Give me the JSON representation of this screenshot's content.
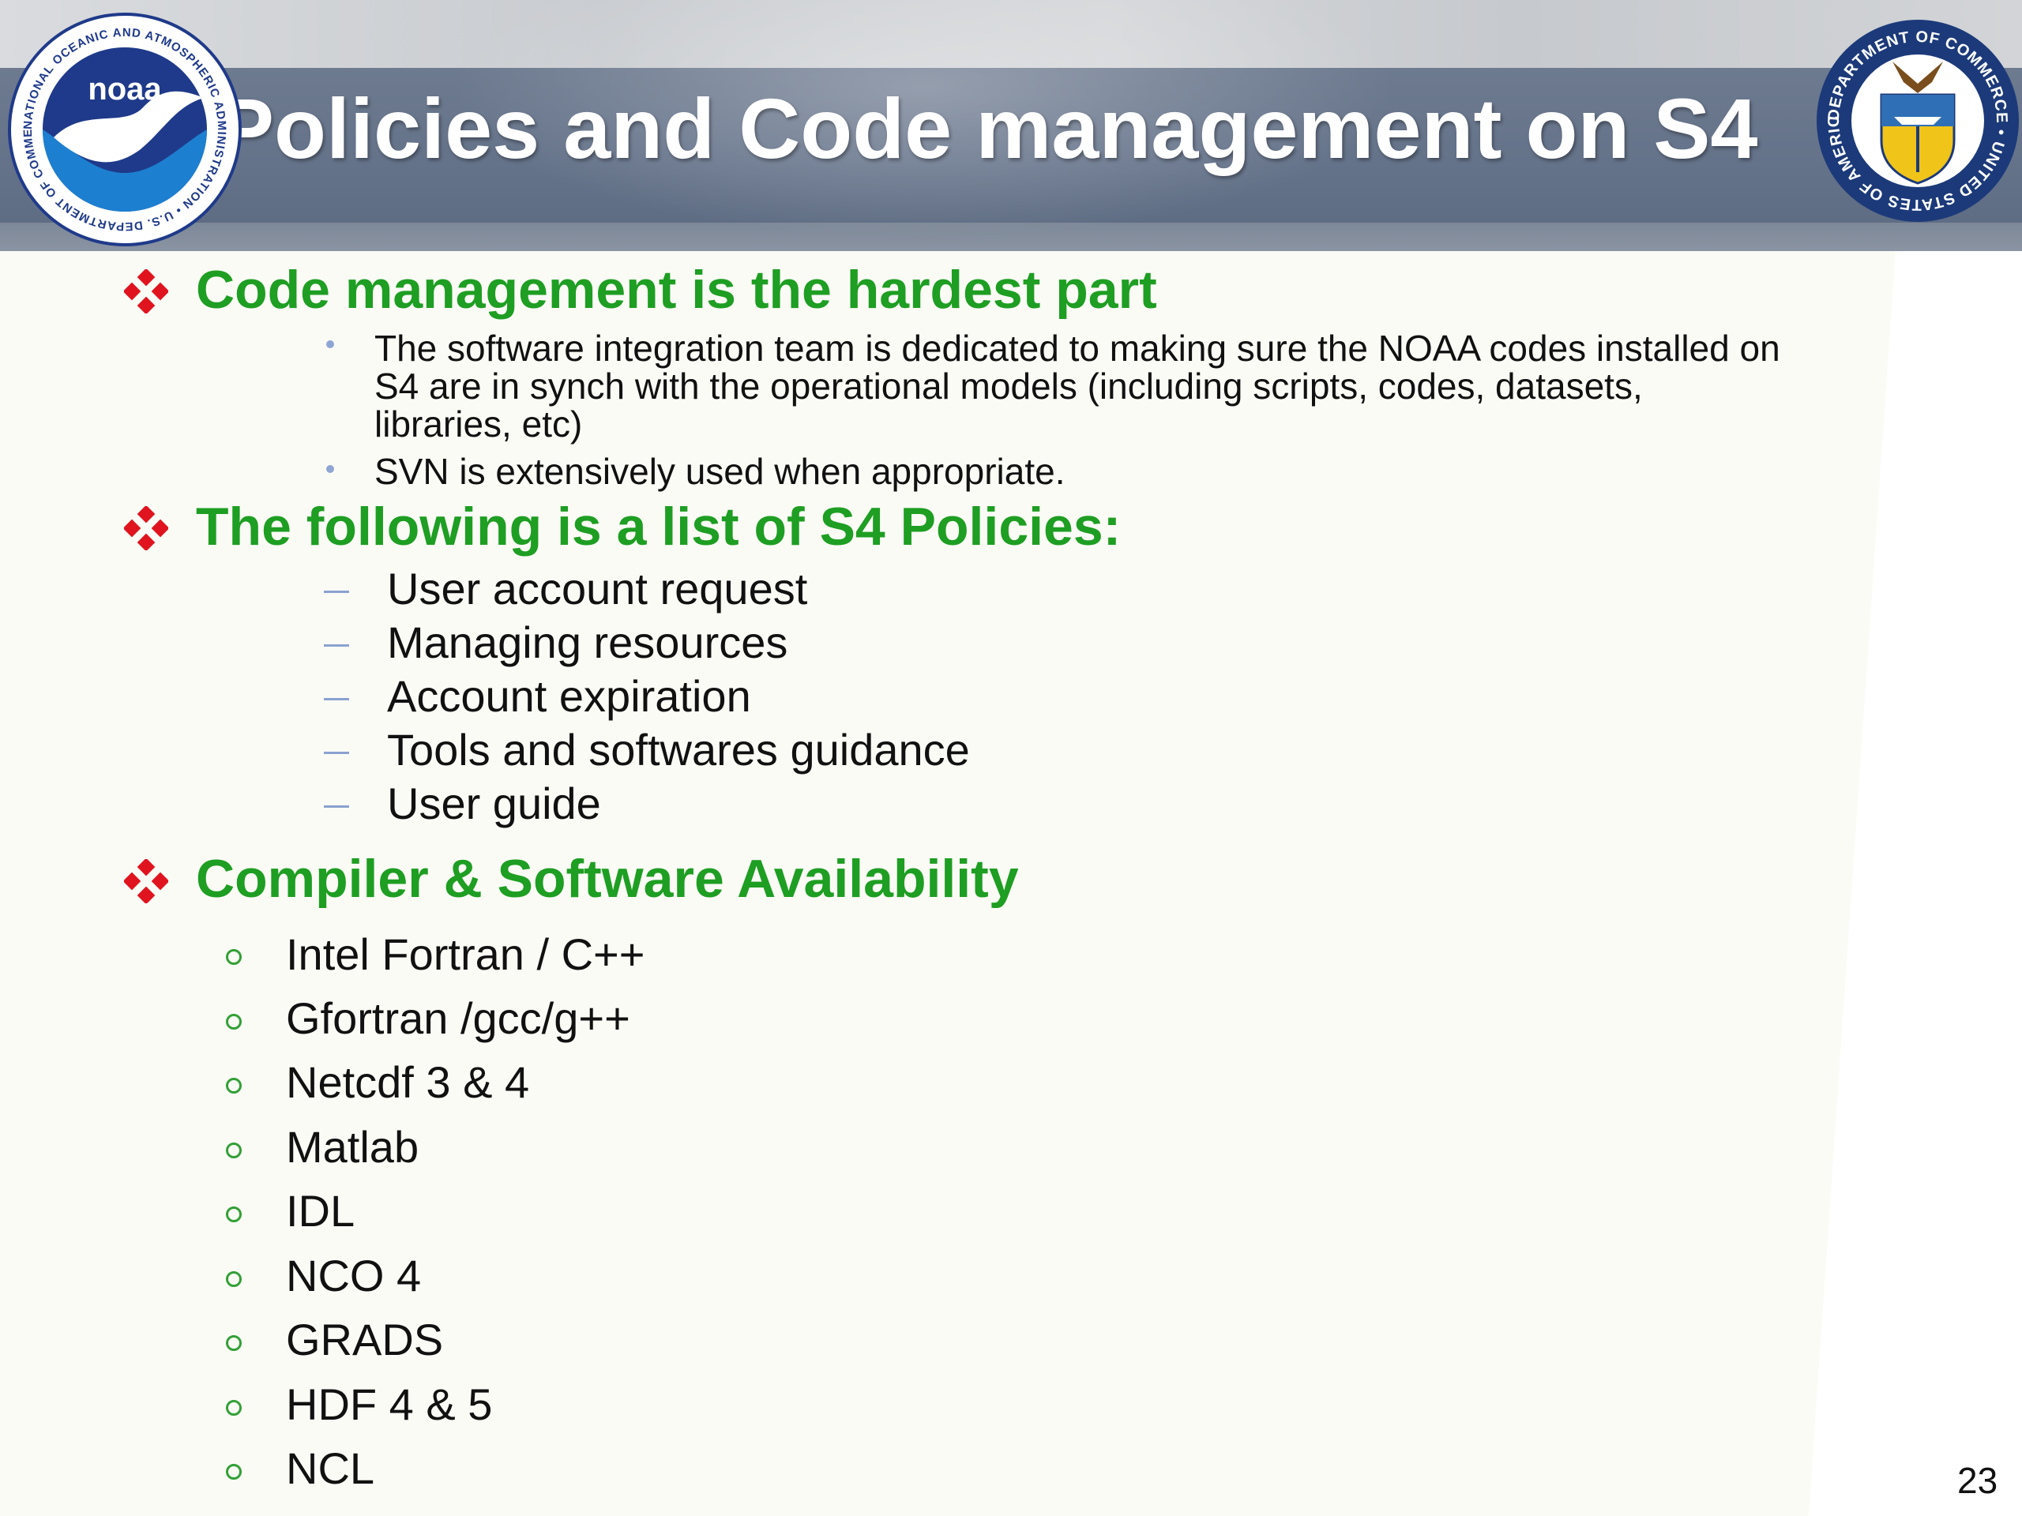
{
  "slide": {
    "title": "Policies and Code management on S4",
    "page_number": "23"
  },
  "logos": {
    "noaa": {
      "center_text": "noaa",
      "ring_text": "NATIONAL OCEANIC AND ATMOSPHERIC ADMINISTRATION • U.S. DEPARTMENT OF COMMERCE •"
    },
    "doc": {
      "ring_text": "DEPARTMENT OF COMMERCE • UNITED STATES OF AMERICA •"
    }
  },
  "sections": [
    {
      "heading": "Code management is the hardest part",
      "items": [
        {
          "lines": [
            "The software integration team is dedicated to making sure the NOAA codes installed on",
            "S4 are in synch with the operational models (including scripts, codes, datasets,",
            "libraries, etc)"
          ]
        },
        {
          "lines": [
            "SVN is extensively used when appropriate."
          ]
        }
      ]
    },
    {
      "heading": "The following is a list of S4 Policies:",
      "items": [
        "User account request",
        "Managing resources",
        "Account expiration",
        "Tools and softwares guidance",
        "User guide"
      ]
    },
    {
      "heading": "Compiler & Software Availability",
      "items": [
        "Intel Fortran / C++",
        "Gfortran /gcc/g++",
        "Netcdf 3 & 4",
        "Matlab",
        "IDL",
        "NCO 4",
        "GRADS",
        "HDF 4 & 5",
        "NCL"
      ]
    }
  ],
  "colors": {
    "heading_green": "#1e9e22",
    "diamond_red": "#e0141e",
    "header_band": "#65738a",
    "bullet_blue": "#8aa2d0",
    "ring_green": "#33a036"
  }
}
